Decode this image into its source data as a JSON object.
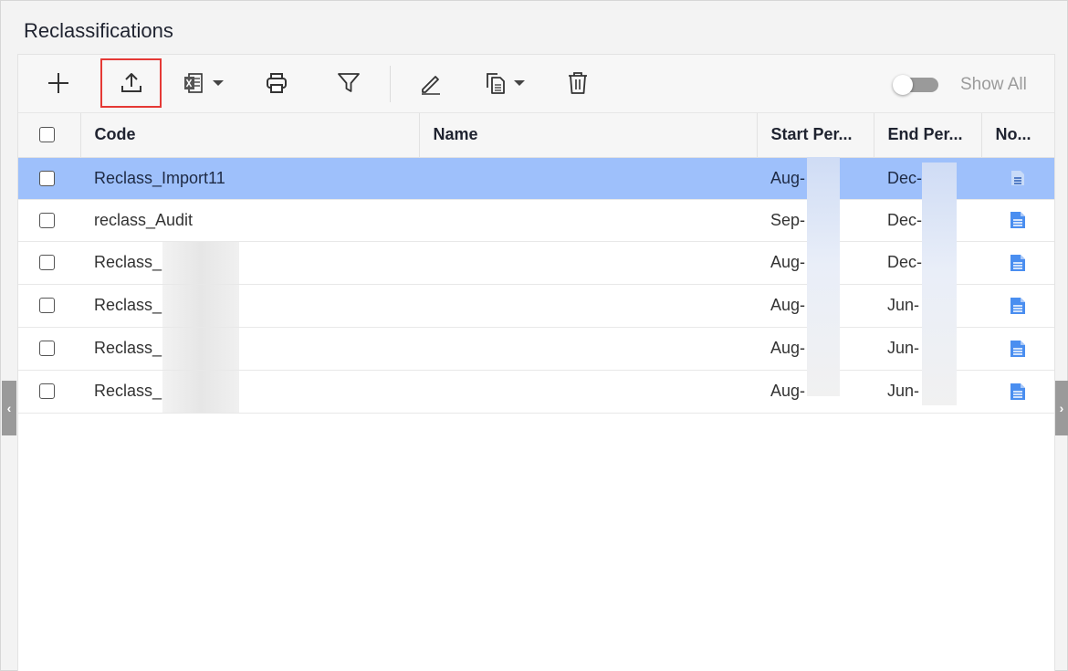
{
  "page": {
    "title": "Reclassifications"
  },
  "toolbar": {
    "add": "add",
    "upload": "upload",
    "export": "export to excel",
    "print": "print",
    "filter": "filter",
    "edit": "edit",
    "copy": "copy",
    "delete": "delete",
    "show_all_label": "Show All",
    "show_all_on": false
  },
  "table": {
    "columns": [
      "Code",
      "Name",
      "Start Per...",
      "End Per...",
      "No..."
    ],
    "rows": [
      {
        "code": "Reclass_Import11",
        "name": "",
        "start": "Aug-",
        "end": "Dec-",
        "selected": true
      },
      {
        "code": "reclass_Audit",
        "name": "",
        "start": "Sep-",
        "end": "Dec-",
        "selected": false
      },
      {
        "code": "Reclass_",
        "name": "",
        "start": "Aug-",
        "end": "Dec-",
        "selected": false
      },
      {
        "code": "Reclass_",
        "name": "",
        "start": "Aug-",
        "end": "Jun-",
        "selected": false
      },
      {
        "code": "Reclass_",
        "name": "",
        "start": "Aug-",
        "end": "Jun-",
        "selected": false
      },
      {
        "code": "Reclass_",
        "name": "",
        "start": "Aug-",
        "end": "Jun-",
        "selected": false
      }
    ]
  },
  "colors": {
    "selected_row": "#9ec0fb",
    "highlight_border": "#e53935",
    "note_icon": "#4a8ef0"
  }
}
